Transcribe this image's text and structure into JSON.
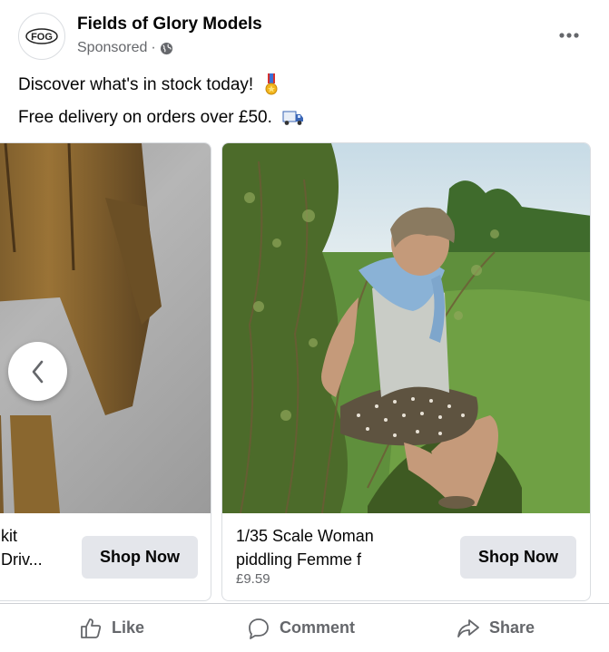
{
  "post": {
    "page_name": "Fields of Glory Models",
    "avatar_text": "FOG",
    "sponsored_label": "Sponsored",
    "separator": "·",
    "body_line1": "Discover what's in stock today!",
    "body_line2": "Free delivery on orders over £50.",
    "icons": {
      "more": "more-options-icon",
      "privacy": "globe-icon",
      "line1_emoji": "medal-emoji",
      "line2_emoji": "delivery-truck-emoji"
    }
  },
  "carousel": {
    "cards": [
      {
        "title": "kit Driv...",
        "title_line1": "kit",
        "title_line2": "Driv...",
        "price": "",
        "cta_label": "Shop Now",
        "image": "figure-brown-jacket-photo"
      },
      {
        "title": "1/35 Scale Woman piddling Femme f",
        "price": "£9.59",
        "cta_label": "Shop Now",
        "image": "woman-figure-in-bushes-photo"
      }
    ],
    "prev_icon": "chevron-left-icon"
  },
  "actions": {
    "like": "Like",
    "comment": "Comment",
    "share": "Share"
  }
}
